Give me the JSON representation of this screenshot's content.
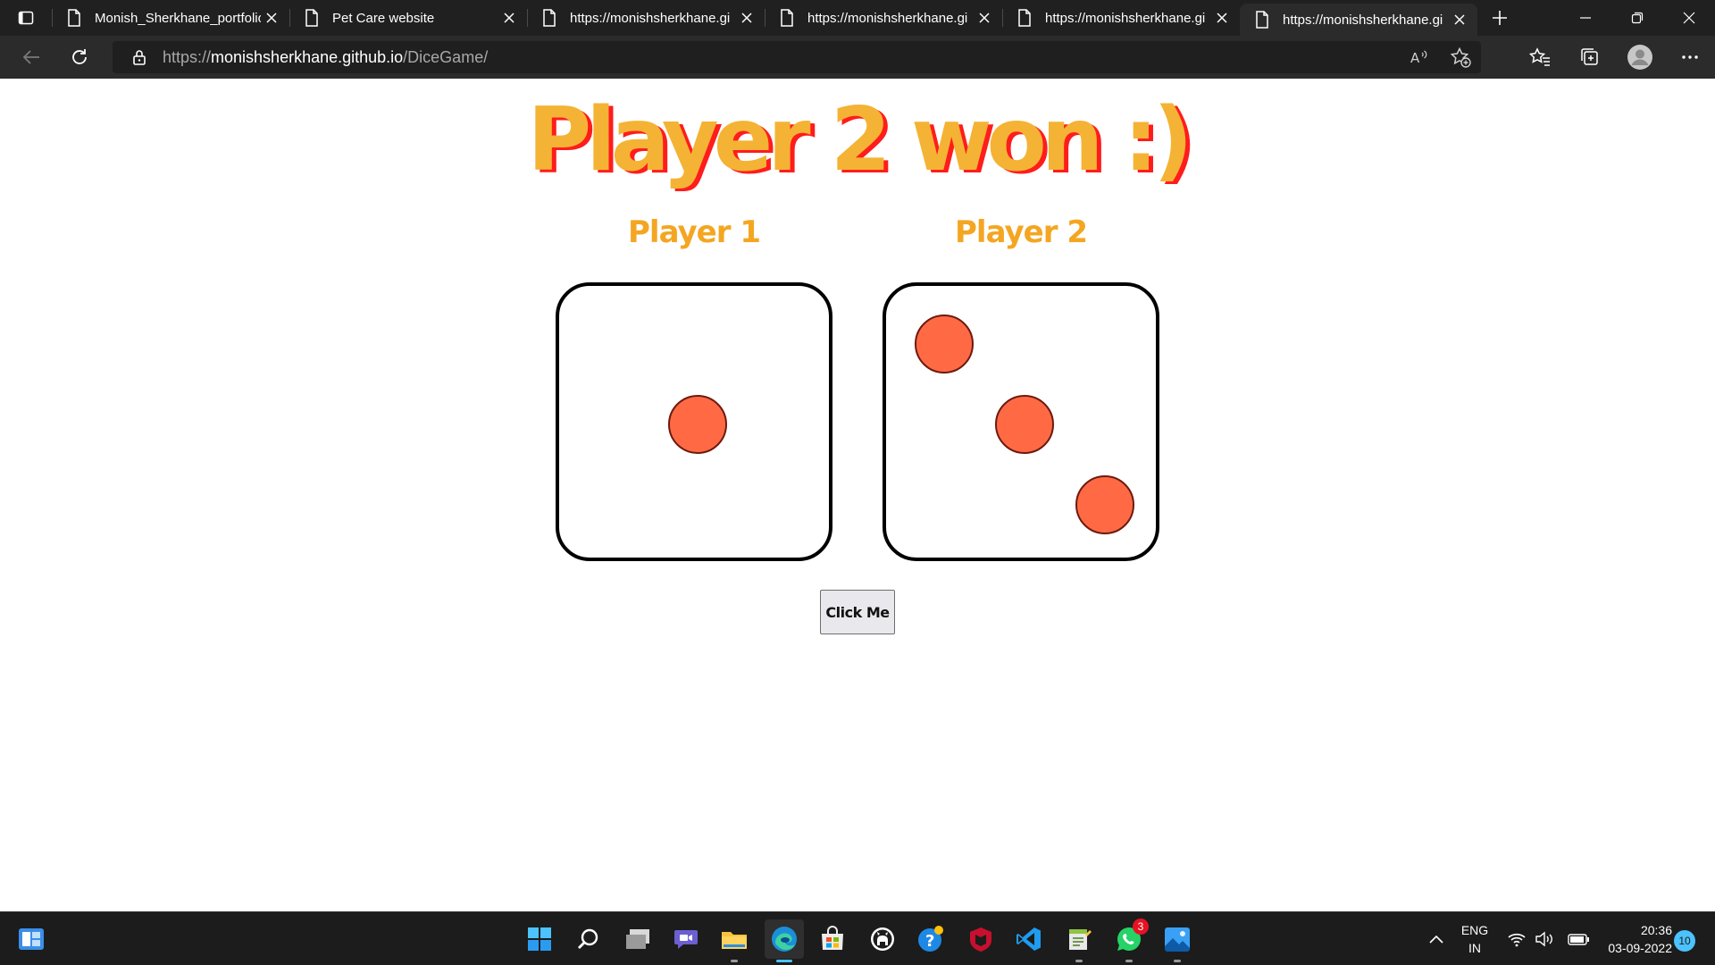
{
  "browser": {
    "tabs": [
      {
        "title": "Monish_Sherkhane_portfolio",
        "active": false
      },
      {
        "title": "Pet Care website",
        "active": false
      },
      {
        "title": "https://monishsherkhane.gi",
        "active": false
      },
      {
        "title": "https://monishsherkhane.gi",
        "active": false
      },
      {
        "title": "https://monishsherkhane.gi",
        "active": false
      },
      {
        "title": "https://monishsherkhane.gi",
        "active": true
      }
    ],
    "address": {
      "scheme": "https://",
      "host": "monishsherkhane.github.io",
      "path": "/DiceGame/"
    },
    "icons": [
      "tab-actions-icon",
      "page-icon",
      "close-icon",
      "new-tab-icon",
      "minimize-icon",
      "restore-icon",
      "window-close-icon",
      "back-icon",
      "refresh-icon",
      "lock-icon",
      "read-aloud-icon",
      "add-favorite-icon",
      "favorites-icon",
      "collections-icon",
      "profile-icon",
      "more-icon"
    ]
  },
  "game": {
    "result_text": "Player 2 won :)",
    "player1_label": "Player 1",
    "player2_label": "Player 2",
    "player1_die": 1,
    "player2_die": 3,
    "button_label": "Click Me"
  },
  "colors": {
    "heading": "#f4b334",
    "heading_shadow": "#ff1c1c",
    "player_label": "#f4a622",
    "pip": "#ff6a45"
  },
  "taskbar": {
    "apps": [
      "windows-start-icon",
      "search-icon",
      "task-view-icon",
      "teams-chat-icon",
      "file-explorer-icon",
      "edge-icon",
      "store-icon",
      "github-icon",
      "help-icon",
      "mcafee-icon",
      "vscode-icon",
      "notepad-icon",
      "whatsapp-icon",
      "photos-icon"
    ],
    "whatsapp_badge": "3",
    "language": "ENG",
    "region": "IN",
    "time": "20:36",
    "date": "03-09-2022",
    "notifications": "10"
  }
}
